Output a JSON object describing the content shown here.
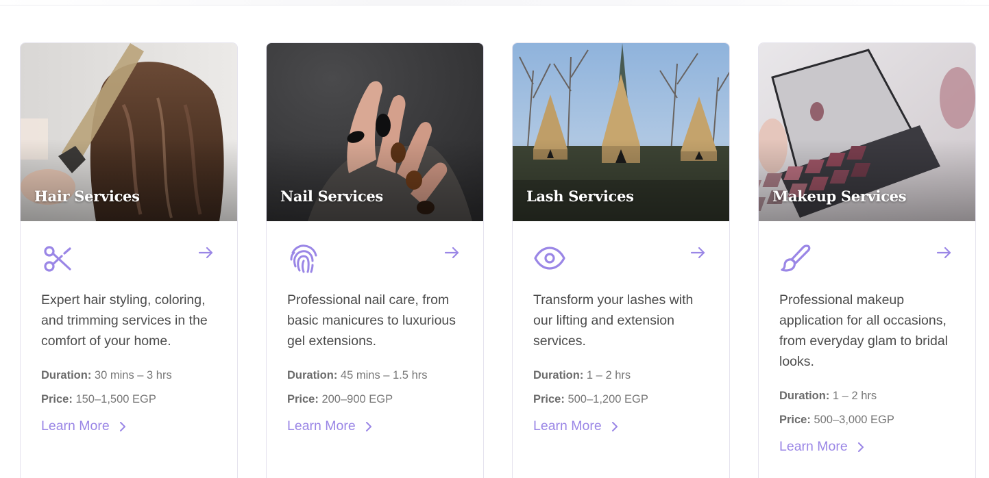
{
  "accent_color": "#9a86e6",
  "cards": [
    {
      "title": "Hair Services",
      "icon": "scissors-icon",
      "description": "Expert hair styling, coloring, and trimming services in the comfort of your home.",
      "duration_label": "Duration:",
      "duration": "30 mins – 3 hrs",
      "price_label": "Price:",
      "price": "150–1,500 EGP",
      "link_label": "Learn More"
    },
    {
      "title": "Nail Services",
      "icon": "fingerprint-icon",
      "description": "Professional nail care, from basic manicures to luxurious gel extensions.",
      "duration_label": "Duration:",
      "duration": "45 mins – 1.5 hrs",
      "price_label": "Price:",
      "price": "200–900 EGP",
      "link_label": "Learn More"
    },
    {
      "title": "Lash Services",
      "icon": "eye-icon",
      "description": "Transform your lashes with our lifting and extension services.",
      "duration_label": "Duration:",
      "duration": "1 – 2 hrs",
      "price_label": "Price:",
      "price": "500–1,200 EGP",
      "link_label": "Learn More"
    },
    {
      "title": "Makeup Services",
      "icon": "brush-icon",
      "description": "Professional makeup application for all occasions, from everyday glam to bridal looks.",
      "duration_label": "Duration:",
      "duration": "1 – 2 hrs",
      "price_label": "Price:",
      "price": "500–3,000 EGP",
      "link_label": "Learn More"
    }
  ]
}
